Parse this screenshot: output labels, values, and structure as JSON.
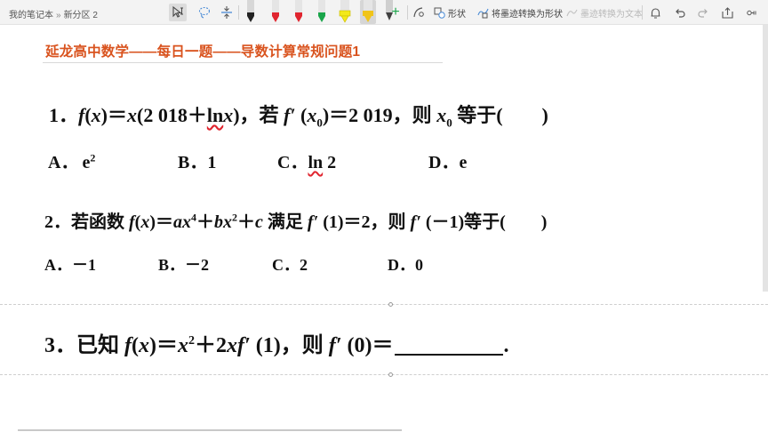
{
  "toolbar": {
    "breadcrumb": {
      "notebook": "我的笔记本",
      "separator": "»",
      "section": "新分区 2"
    },
    "shapes_label": "形状",
    "ink_to_shape_label": "将墨迹转换为形状",
    "ink_to_text_label": "墨迹转换为文本"
  },
  "pens": [
    {
      "color": "#222222"
    },
    {
      "color": "#e0252f"
    },
    {
      "color": "#e0252f"
    },
    {
      "color": "#1aa54a"
    },
    {
      "color": "#f3e91a"
    },
    {
      "color": "#f0c419"
    },
    {
      "color": "#3f3f3f"
    }
  ],
  "accent_color": "#d9531e",
  "page": {
    "title": "延龙高中数学——每日一题——导数计算常规问题1",
    "q1": {
      "num": "1．",
      "f": "f",
      "p1": "(",
      "x1": "x",
      "p2": ")＝",
      "x2": "x",
      "p3": "(2 018＋",
      "ln": "ln",
      "x3": "x",
      "p4": ")，若 ",
      "fp": "f′",
      "p5": " (",
      "x0": "x",
      "sub0": "0",
      "p6": ")＝2 019，则 ",
      "x0b": "x",
      "sub0b": "0",
      "p7": " 等于(　　)",
      "options": {
        "A_label": "A．",
        "A_val": "e",
        "A_sup": "2",
        "B": "B．1",
        "C_label": "C．",
        "C_ln": "ln",
        "C_val": " 2",
        "D": "D．e"
      }
    },
    "q2": {
      "num": "2．若函数 ",
      "f": "f",
      "p1": "(",
      "x1": "x",
      "p2": ")＝",
      "a": "ax",
      "sup4": "4",
      "plus1": "＋",
      "b": "bx",
      "sup2": "2",
      "plus2": "＋",
      "c": "c",
      "p3": " 满足 ",
      "fp1": "f′",
      "p4": " (1)＝2，则 ",
      "fp2": "f′",
      "p5": " (－1)等于(　　)",
      "options": {
        "A": "A．－1",
        "B": "B．－2",
        "C": "C．2",
        "D": "D．0"
      }
    },
    "q3": {
      "num": "3．已知 ",
      "f": "f",
      "p1": "(",
      "x1": "x",
      "p2": ")＝",
      "x2": "x",
      "sup2": "2",
      "p3": "＋2",
      "x3": "x",
      "fp1": "f′",
      "p4": " (1)，则 ",
      "fp2": "f′",
      "p5": " (0)＝",
      "end": "."
    }
  }
}
